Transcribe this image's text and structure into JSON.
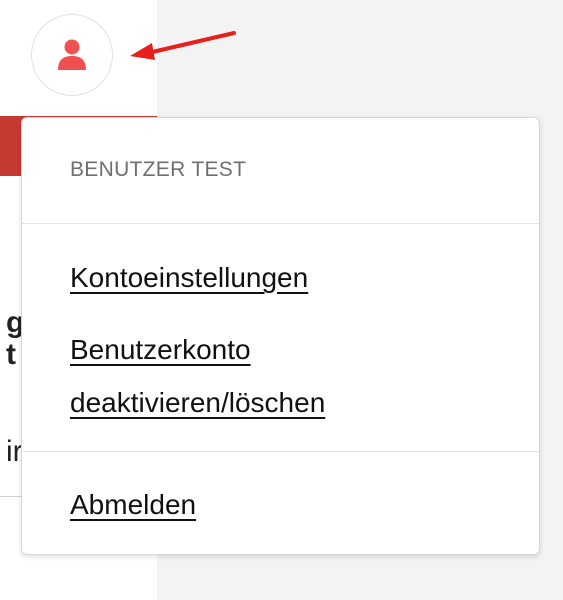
{
  "colors": {
    "accent": "#f0504f",
    "annotation_arrow": "#e8201c",
    "background_bar": "#c73a33"
  },
  "icons": {
    "avatar": "user-icon",
    "annotation": "arrow-pointer"
  },
  "background": {
    "fragments": [
      "g",
      "t",
      "ir"
    ]
  },
  "user_menu": {
    "header": "BENUTZER TEST",
    "account_settings": "Kontoeinstellungen",
    "deactivate_line1": "Benutzerkonto",
    "deactivate_line2": "deaktivieren/löschen",
    "logout": "Abmelden"
  }
}
